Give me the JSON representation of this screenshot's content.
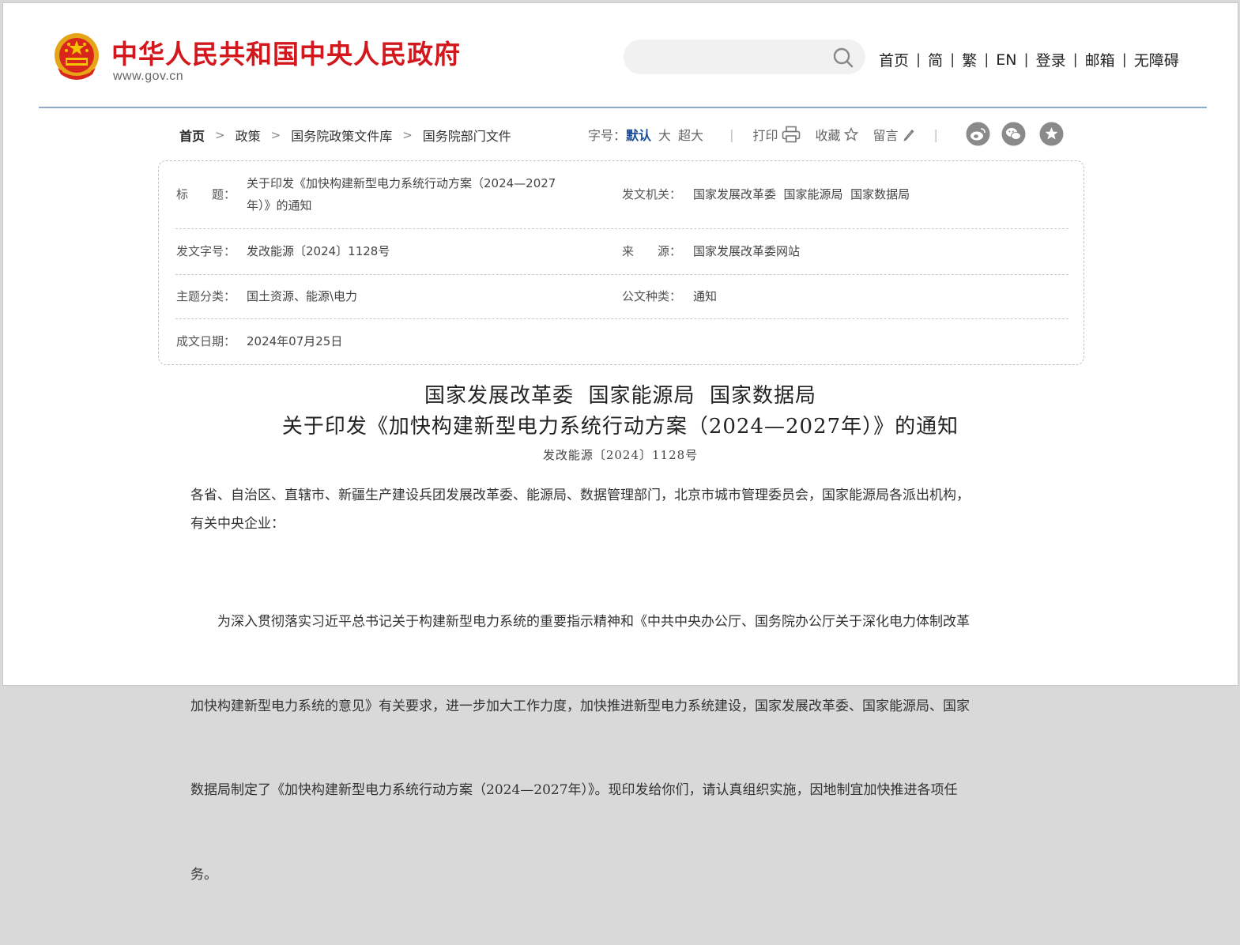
{
  "header": {
    "site_name": "中华人民共和国中央人民政府",
    "site_url": "www.gov.cn",
    "search_placeholder": "",
    "nav": [
      "首页",
      "简",
      "繁",
      "EN",
      "登录",
      "邮箱",
      "无障碍"
    ]
  },
  "breadcrumb": [
    "首页",
    "政策",
    "国务院政策文件库",
    "国务院部门文件"
  ],
  "toolbar": {
    "font_size_label": "字号：",
    "font_sizes": [
      "默认",
      "大",
      "超大"
    ],
    "active_font_size": "默认",
    "print_label": "打印",
    "favorite_label": "收藏",
    "comment_label": "留言"
  },
  "share_icons": [
    "weibo-icon",
    "wechat-icon",
    "star-share-icon"
  ],
  "meta": {
    "title_label": "标　　题：",
    "title_line1": "关于印发《加快构建新型电力系统行动方案（2024—2027",
    "title_line2": "年）》的通知",
    "issuer_label": "发文机关：",
    "issuer_value": "国家发展改革委  国家能源局  国家数据局",
    "doc_no_label": "发文字号：",
    "doc_no_value": "发改能源〔2024〕1128号",
    "source_label": "来　　源：",
    "source_value": "国家发展改革委网站",
    "topic_label": "主题分类：",
    "topic_value": "国土资源、能源\\电力",
    "type_label": "公文种类：",
    "type_value": "通知",
    "date_label": "成文日期：",
    "date_value": "2024年07月25日"
  },
  "article": {
    "title_line1": "国家发展改革委  国家能源局  国家数据局",
    "title_line2": "关于印发《加快构建新型电力系统行动方案（2024—2027年）》的通知",
    "doc_no": "发改能源〔2024〕1128号",
    "addressee_line1": "各省、自治区、直辖市、新疆生产建设兵团发展改革委、能源局、数据管理部门，北京市城市管理委员会，国家能源局各派出机构，",
    "addressee_line2": "有关中央企业：",
    "para_line1": "　　为深入贯彻落实习近平总书记关于构建新型电力系统的重要指示精神和《中共中央办公厅、国务院办公厅关于深化电力体制改革",
    "para_line2": "加快构建新型电力系统的意见》有关要求，进一步加大工作力度，加快推进新型电力系统建设，国家发展改革委、国家能源局、国家",
    "para_line3": "数据局制定了《加快构建新型电力系统行动方案（2024—2027年）》。现印发给你们，请认真组织实施，因地制宜加快推进各项任",
    "para_line4": "务。"
  },
  "colors": {
    "brand_red": "#d2181d",
    "link_blue": "#1a4f9c",
    "rule_blue": "#8ea9c5"
  }
}
